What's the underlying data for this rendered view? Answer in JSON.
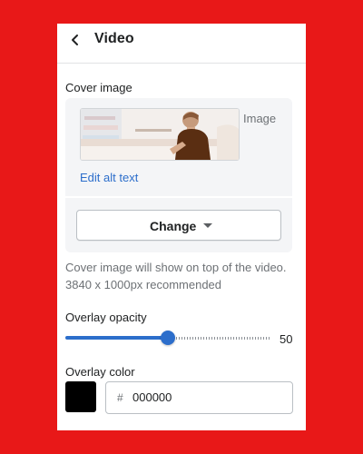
{
  "header": {
    "title": "Video"
  },
  "cover_image": {
    "label": "Cover image",
    "image_caption": "Image",
    "edit_alt_text": "Edit alt text",
    "change_button": "Change",
    "help_text": "Cover image will show on top of the video. 3840 x 1000px recommended"
  },
  "overlay_opacity": {
    "label": "Overlay opacity",
    "value": 50,
    "value_text": "50",
    "max": 100
  },
  "overlay_color": {
    "label": "Overlay color",
    "hash": "#",
    "value": "000000",
    "swatch_color": "#000000"
  },
  "colors": {
    "background": "#e81818",
    "accent": "#2c6ecb",
    "card": "#f4f5f7"
  }
}
